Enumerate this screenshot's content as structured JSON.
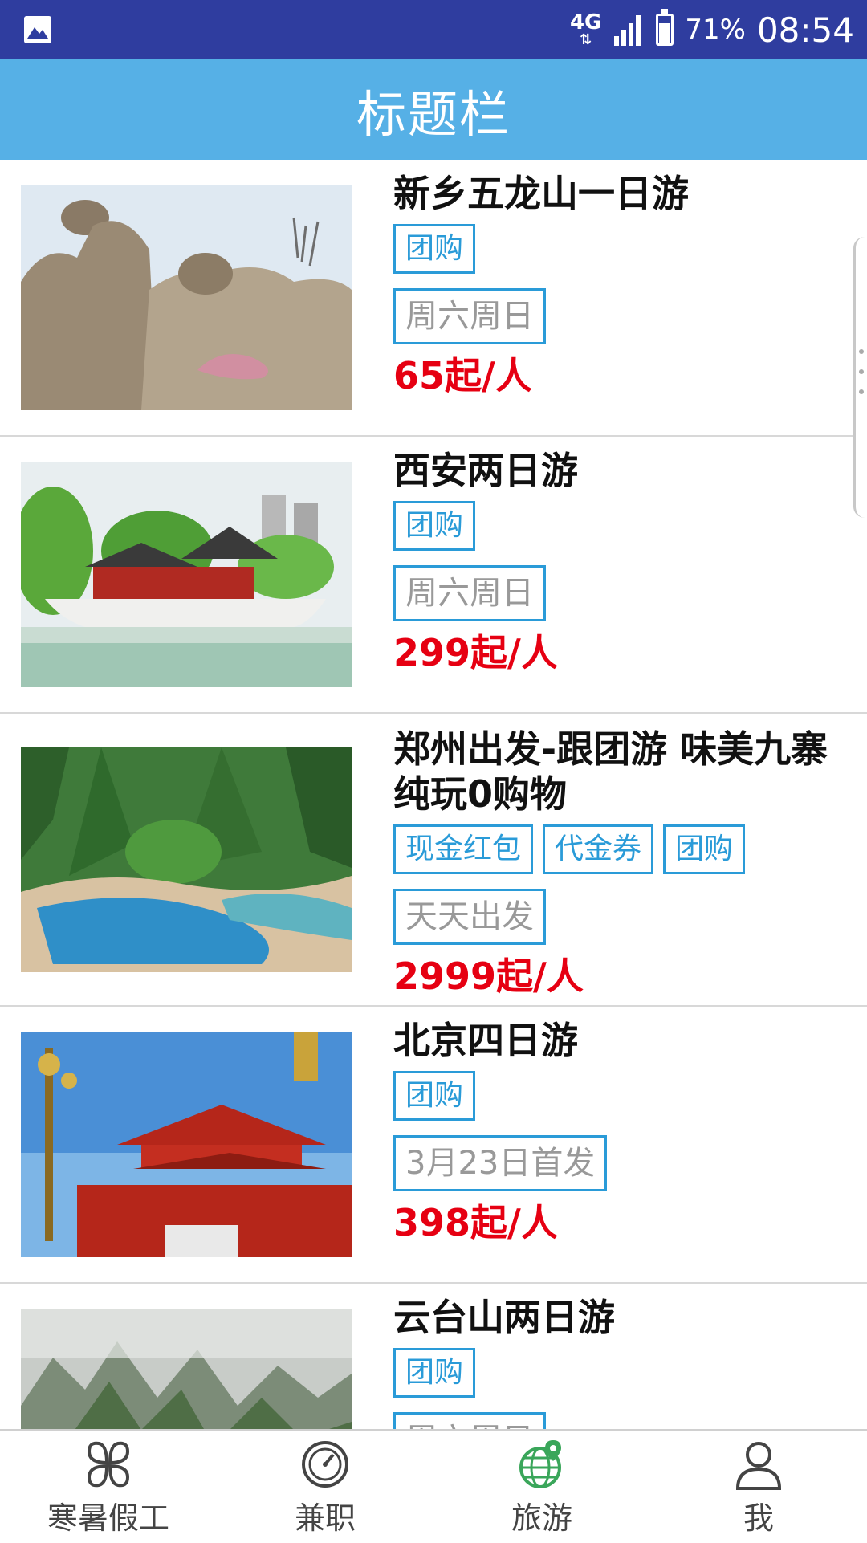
{
  "status_bar": {
    "network": "4G",
    "battery": "71%",
    "time": "08:54"
  },
  "header": {
    "title": "标题栏"
  },
  "trips": [
    {
      "title": "新乡五龙山一日游",
      "tags": [
        "团购"
      ],
      "schedule": "周六周日",
      "price": "65起/人"
    },
    {
      "title": "西安两日游",
      "tags": [
        "团购"
      ],
      "schedule": "周六周日",
      "price": "299起/人"
    },
    {
      "title": "郑州出发-跟团游 味美九寨 纯玩0购物",
      "tags": [
        "现金红包",
        "代金券",
        "团购"
      ],
      "schedule": "天天出发",
      "price": "2999起/人"
    },
    {
      "title": "北京四日游",
      "tags": [
        "团购"
      ],
      "schedule": "3月23日首发",
      "price": "398起/人"
    },
    {
      "title": "云台山两日游",
      "tags": [
        "团购"
      ],
      "schedule": "周六周日",
      "price": ""
    }
  ],
  "bottom_nav": [
    {
      "label": "寒暑假工",
      "icon": "clover-icon",
      "active": false
    },
    {
      "label": "兼职",
      "icon": "clock-icon",
      "active": false
    },
    {
      "label": "旅游",
      "icon": "globe-icon",
      "active": true
    },
    {
      "label": "我",
      "icon": "user-icon",
      "active": false
    }
  ],
  "colors": {
    "status_bar": "#2f3d9f",
    "title_bar": "#56b0e6",
    "tag_border": "#2a9bd8",
    "price": "#e60012",
    "nav_active": "#3aa65a"
  }
}
